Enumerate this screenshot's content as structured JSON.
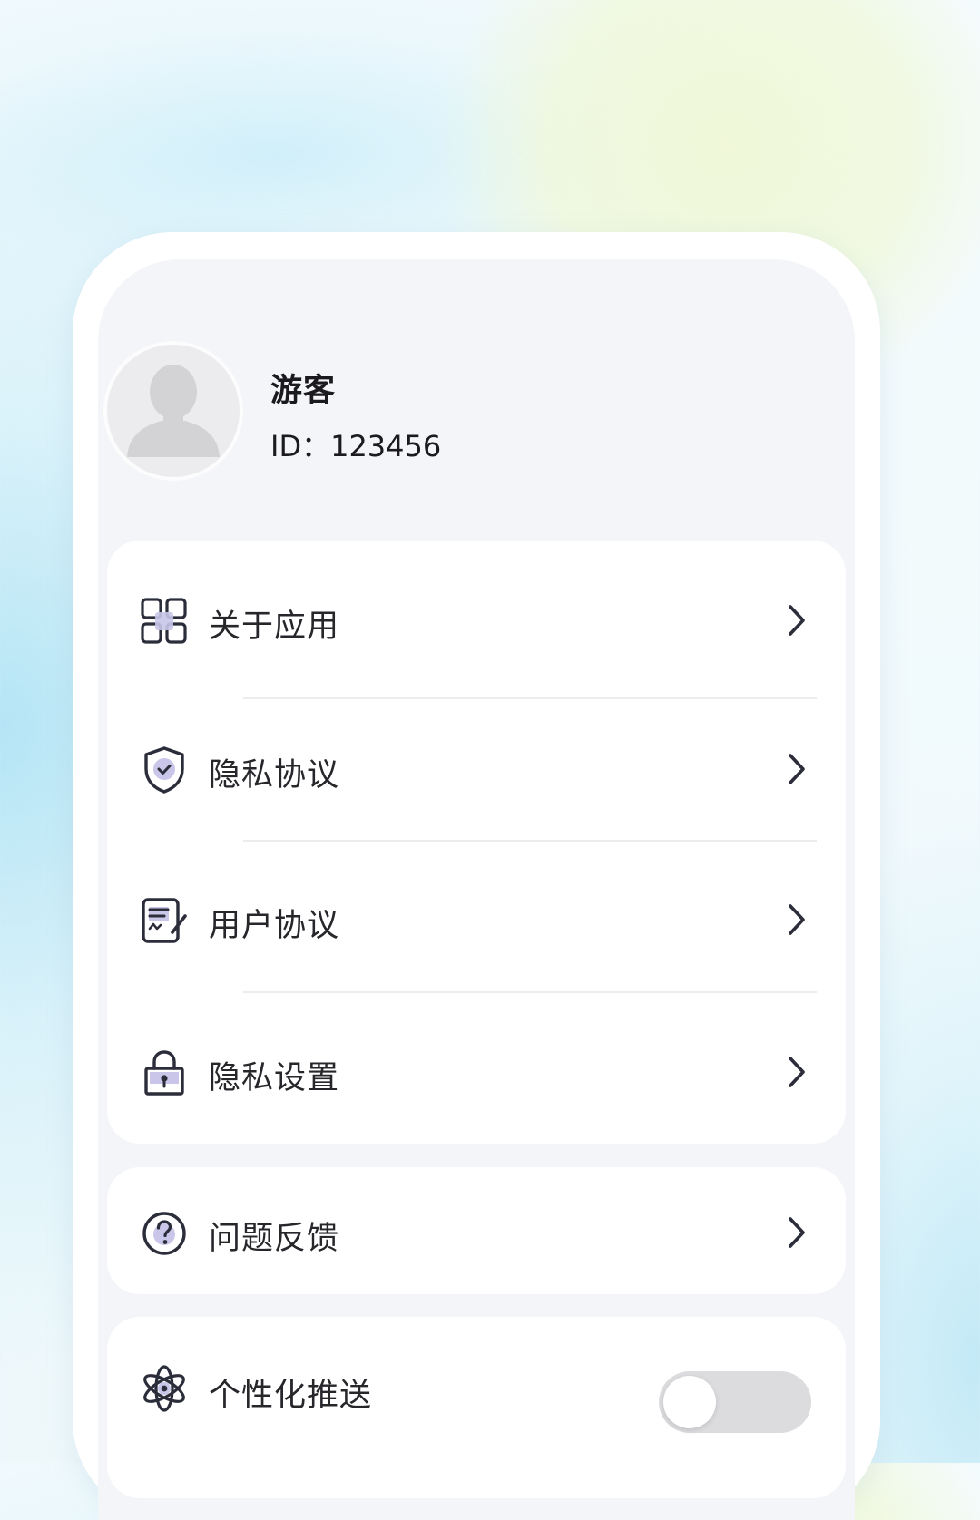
{
  "profile": {
    "name": "游客",
    "id_text": "ID：123456",
    "avatar_icon": "default-avatar-icon"
  },
  "menu_main": [
    {
      "label": "关于应用",
      "icon": "apps-grid-icon"
    },
    {
      "label": "隐私协议",
      "icon": "shield-check-icon"
    },
    {
      "label": "用户协议",
      "icon": "document-sign-icon"
    },
    {
      "label": "隐私设置",
      "icon": "lock-icon"
    }
  ],
  "menu_feedback": {
    "label": "问题反馈",
    "icon": "question-circle-icon"
  },
  "menu_push": {
    "label": "个性化推送",
    "icon": "atom-icon",
    "enabled": false
  },
  "colors": {
    "accent_icon_fill": "#c9c6e9",
    "icon_stroke": "#2b2d3a",
    "toggle_off": "#dcdcdf"
  }
}
